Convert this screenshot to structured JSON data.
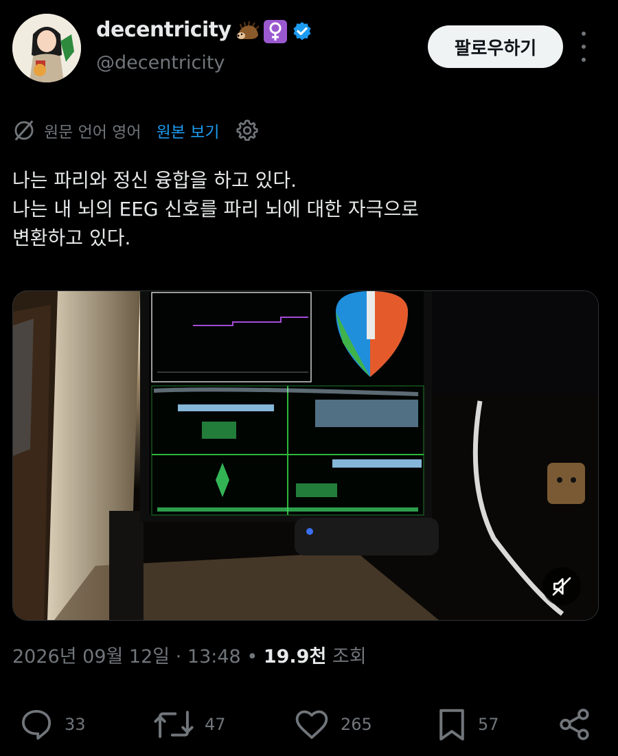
{
  "author": {
    "display_name": "decentricity",
    "handle": "@decentricity",
    "badges": [
      "hedgehog-emoji",
      "female-sign-emoji",
      "verified-badge"
    ],
    "badge_colors": {
      "verified": "#1d9bf0",
      "female_sign_bg": "#9b59d0"
    }
  },
  "header": {
    "follow_label": "팔로우하기",
    "more_icon": "more-vertical-icon"
  },
  "translation": {
    "icon": "globe-slash-icon",
    "source_language_label": "원문 언어 영어",
    "view_original_label": "원본 보기",
    "settings_icon": "gear-icon"
  },
  "tweet": {
    "lines": [
      "나는 파리와 정신 융합을 하고 있다.",
      "나는 내 뇌의 EEG 신호를 파리 뇌에 대한 자극으로",
      "변환하고 있다."
    ]
  },
  "media": {
    "type": "video",
    "mute_icon": "speaker-muted-icon"
  },
  "meta": {
    "date": "2026년 09월 12일",
    "separator": "·",
    "time": "13:48",
    "dot": "•",
    "views_count": "19.9천",
    "views_label": "조회"
  },
  "actions": {
    "reply": {
      "icon": "reply-icon",
      "count": "33"
    },
    "repost": {
      "icon": "repost-icon",
      "count": "47"
    },
    "like": {
      "icon": "heart-icon",
      "count": "265"
    },
    "bookmark": {
      "icon": "bookmark-icon",
      "count": "57"
    },
    "share": {
      "icon": "share-icon"
    }
  },
  "colors": {
    "background": "#000000",
    "text": "#e7e9ea",
    "muted": "#71767b",
    "accent": "#1d9bf0"
  }
}
